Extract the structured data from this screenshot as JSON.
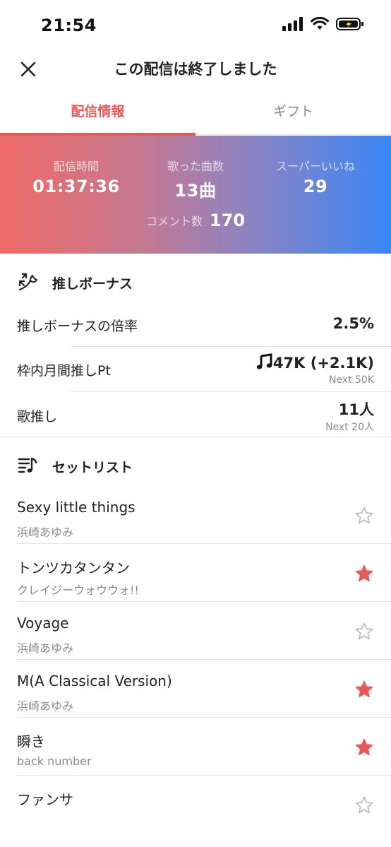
{
  "status_bar": {
    "time": "21:54"
  },
  "header": {
    "title": "この配信は終了しました"
  },
  "tabs": [
    {
      "label": "配信情報",
      "active": true
    },
    {
      "label": "ギフト",
      "active": false
    }
  ],
  "stats": {
    "duration": {
      "label": "配信時間",
      "value": "01:37:36"
    },
    "songs_sung": {
      "label": "歌った曲数",
      "value": "13曲"
    },
    "super_likes": {
      "label": "スーパーいいね",
      "value": "29"
    },
    "comments": {
      "label": "コメント数",
      "value": "170"
    }
  },
  "oshi_bonus": {
    "title": "推しボーナス",
    "rows": [
      {
        "label": "推しボーナスの倍率",
        "value": "2.5%"
      },
      {
        "label": "枠内月間推しPt",
        "value": "47K (+2.1K)",
        "sub": "Next 50K"
      },
      {
        "label": "歌推し",
        "value": "11人",
        "sub": "Next 20人"
      }
    ]
  },
  "setlist": {
    "title": "セットリスト",
    "songs": [
      {
        "title": "Sexy little things",
        "artist": "浜崎あゆみ",
        "starred": false
      },
      {
        "title": "トンツカタンタン",
        "artist": "クレイジーウォウウォ!!",
        "starred": true
      },
      {
        "title": "Voyage",
        "artist": "浜崎あゆみ",
        "starred": false
      },
      {
        "title": "M(A Classical Version)",
        "artist": "浜崎あゆみ",
        "starred": true
      },
      {
        "title": "瞬き",
        "artist": "back number",
        "starred": true
      },
      {
        "title": "ファンサ",
        "artist": "",
        "starred": false
      }
    ]
  },
  "colors": {
    "accent": "#e8574f",
    "star_filled": "#e85a5a",
    "star_empty": "#bdbdbd",
    "gradient_start": "#ef6a66",
    "gradient_end": "#3a86f5"
  },
  "icons": {
    "close": "close-icon",
    "oshi_bonus": "wing-arrow-icon",
    "setlist": "music-list-icon",
    "points": "music-note-icon",
    "star": "star-icon"
  }
}
